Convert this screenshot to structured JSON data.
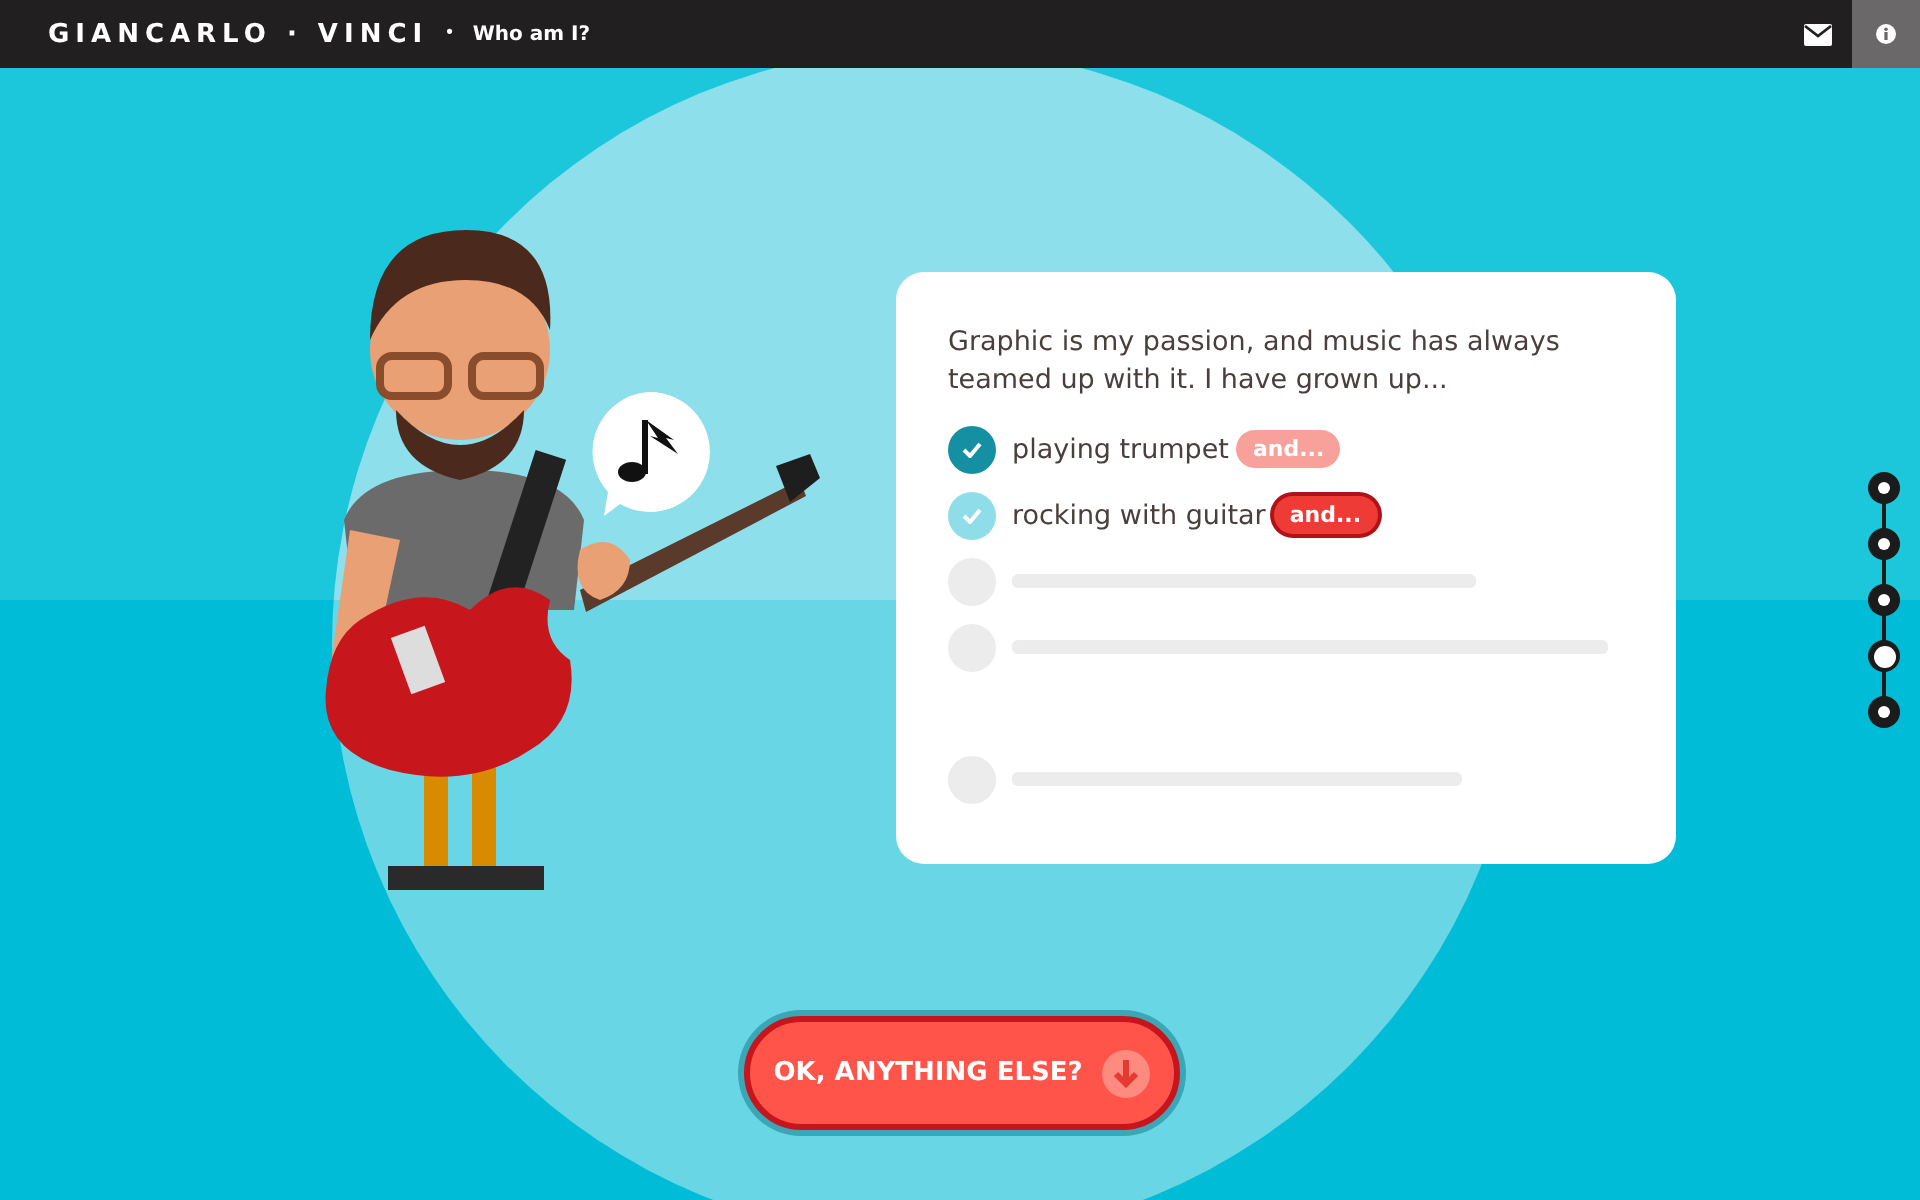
{
  "header": {
    "brand": "GIANCARLO · VINCI",
    "separator": "•",
    "subtitle": "Who am I?"
  },
  "card": {
    "intro": "Graphic is my passion, and music has always teamed up with it. I have grown up...",
    "items": [
      {
        "kind": "answer",
        "text": "playing trumpet",
        "checked": true,
        "color": "#1590a3",
        "button": {
          "label": "and...",
          "active": false
        }
      },
      {
        "kind": "answer",
        "text": "rocking with guitar",
        "checked": true,
        "color": "#8fdde9",
        "button": {
          "label": "and...",
          "active": true
        }
      },
      {
        "kind": "blank"
      },
      {
        "kind": "blank"
      },
      {
        "kind": "empty"
      },
      {
        "kind": "blank"
      }
    ]
  },
  "nav_dots": [
    {
      "selected": false
    },
    {
      "selected": false
    },
    {
      "selected": false
    },
    {
      "selected": true
    },
    {
      "selected": false
    }
  ],
  "cta": {
    "label": "OK, ANYTHING ELSE?"
  }
}
